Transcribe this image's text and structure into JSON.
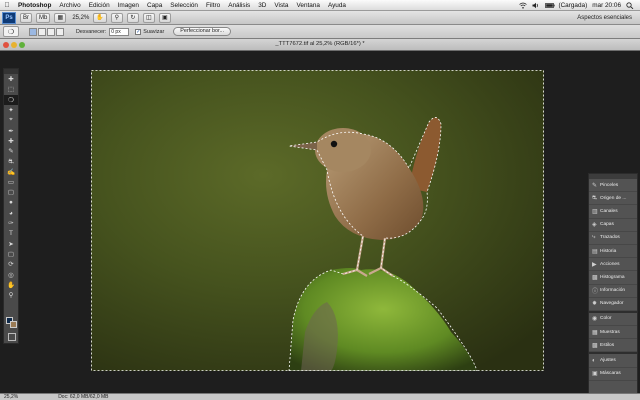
{
  "menubar": {
    "apple_icon": "apple-icon",
    "items": [
      "Photoshop",
      "Archivo",
      "Edición",
      "Imagen",
      "Capa",
      "Selección",
      "Filtro",
      "Análisis",
      "3D",
      "Vista",
      "Ventana",
      "Ayuda"
    ],
    "battery_status": "(Cargada)",
    "clock": "mar 20:06"
  },
  "appbar": {
    "logo": "Ps",
    "zoom": "25,2%",
    "workspace": "Aspectos esenciales"
  },
  "options": {
    "feather_label": "Desvanecer:",
    "feather_value": "0 px",
    "antialias_label": "Suavizar",
    "antialias_checked": true,
    "refine_edge_label": "Perfeccionar bor..."
  },
  "document": {
    "title": "_TTT7672.tif al 25,2% (RGB/16*) *"
  },
  "panels": {
    "group1": [
      {
        "label": "Pinceles",
        "icon": "brush-icon"
      },
      {
        "label": "Origen de ...",
        "icon": "clone-source-icon"
      },
      {
        "label": "Canales",
        "icon": "channels-icon"
      },
      {
        "label": "Capas",
        "icon": "layers-icon"
      },
      {
        "label": "Trazados",
        "icon": "paths-icon"
      },
      {
        "label": "Historia",
        "icon": "history-icon"
      },
      {
        "label": "Acciones",
        "icon": "actions-icon"
      },
      {
        "label": "Histograma",
        "icon": "histogram-icon"
      },
      {
        "label": "Información",
        "icon": "info-icon"
      },
      {
        "label": "Navegador",
        "icon": "navigator-icon"
      }
    ],
    "group2": [
      {
        "label": "Color",
        "icon": "color-icon"
      },
      {
        "label": "Muestras",
        "icon": "swatches-icon"
      },
      {
        "label": "Estilos",
        "icon": "styles-icon"
      }
    ],
    "group3": [
      {
        "label": "Ajustes",
        "icon": "adjustments-icon"
      },
      {
        "label": "Máscaras",
        "icon": "masks-icon"
      }
    ]
  },
  "status": {
    "zoom": "25,2%",
    "doc_info": "Doc: 62,0 MB/62,0 MB"
  },
  "colors": {
    "foreground": "#0f2a4a",
    "background": "#9a7b55",
    "workspace": "#1e1e1e"
  }
}
